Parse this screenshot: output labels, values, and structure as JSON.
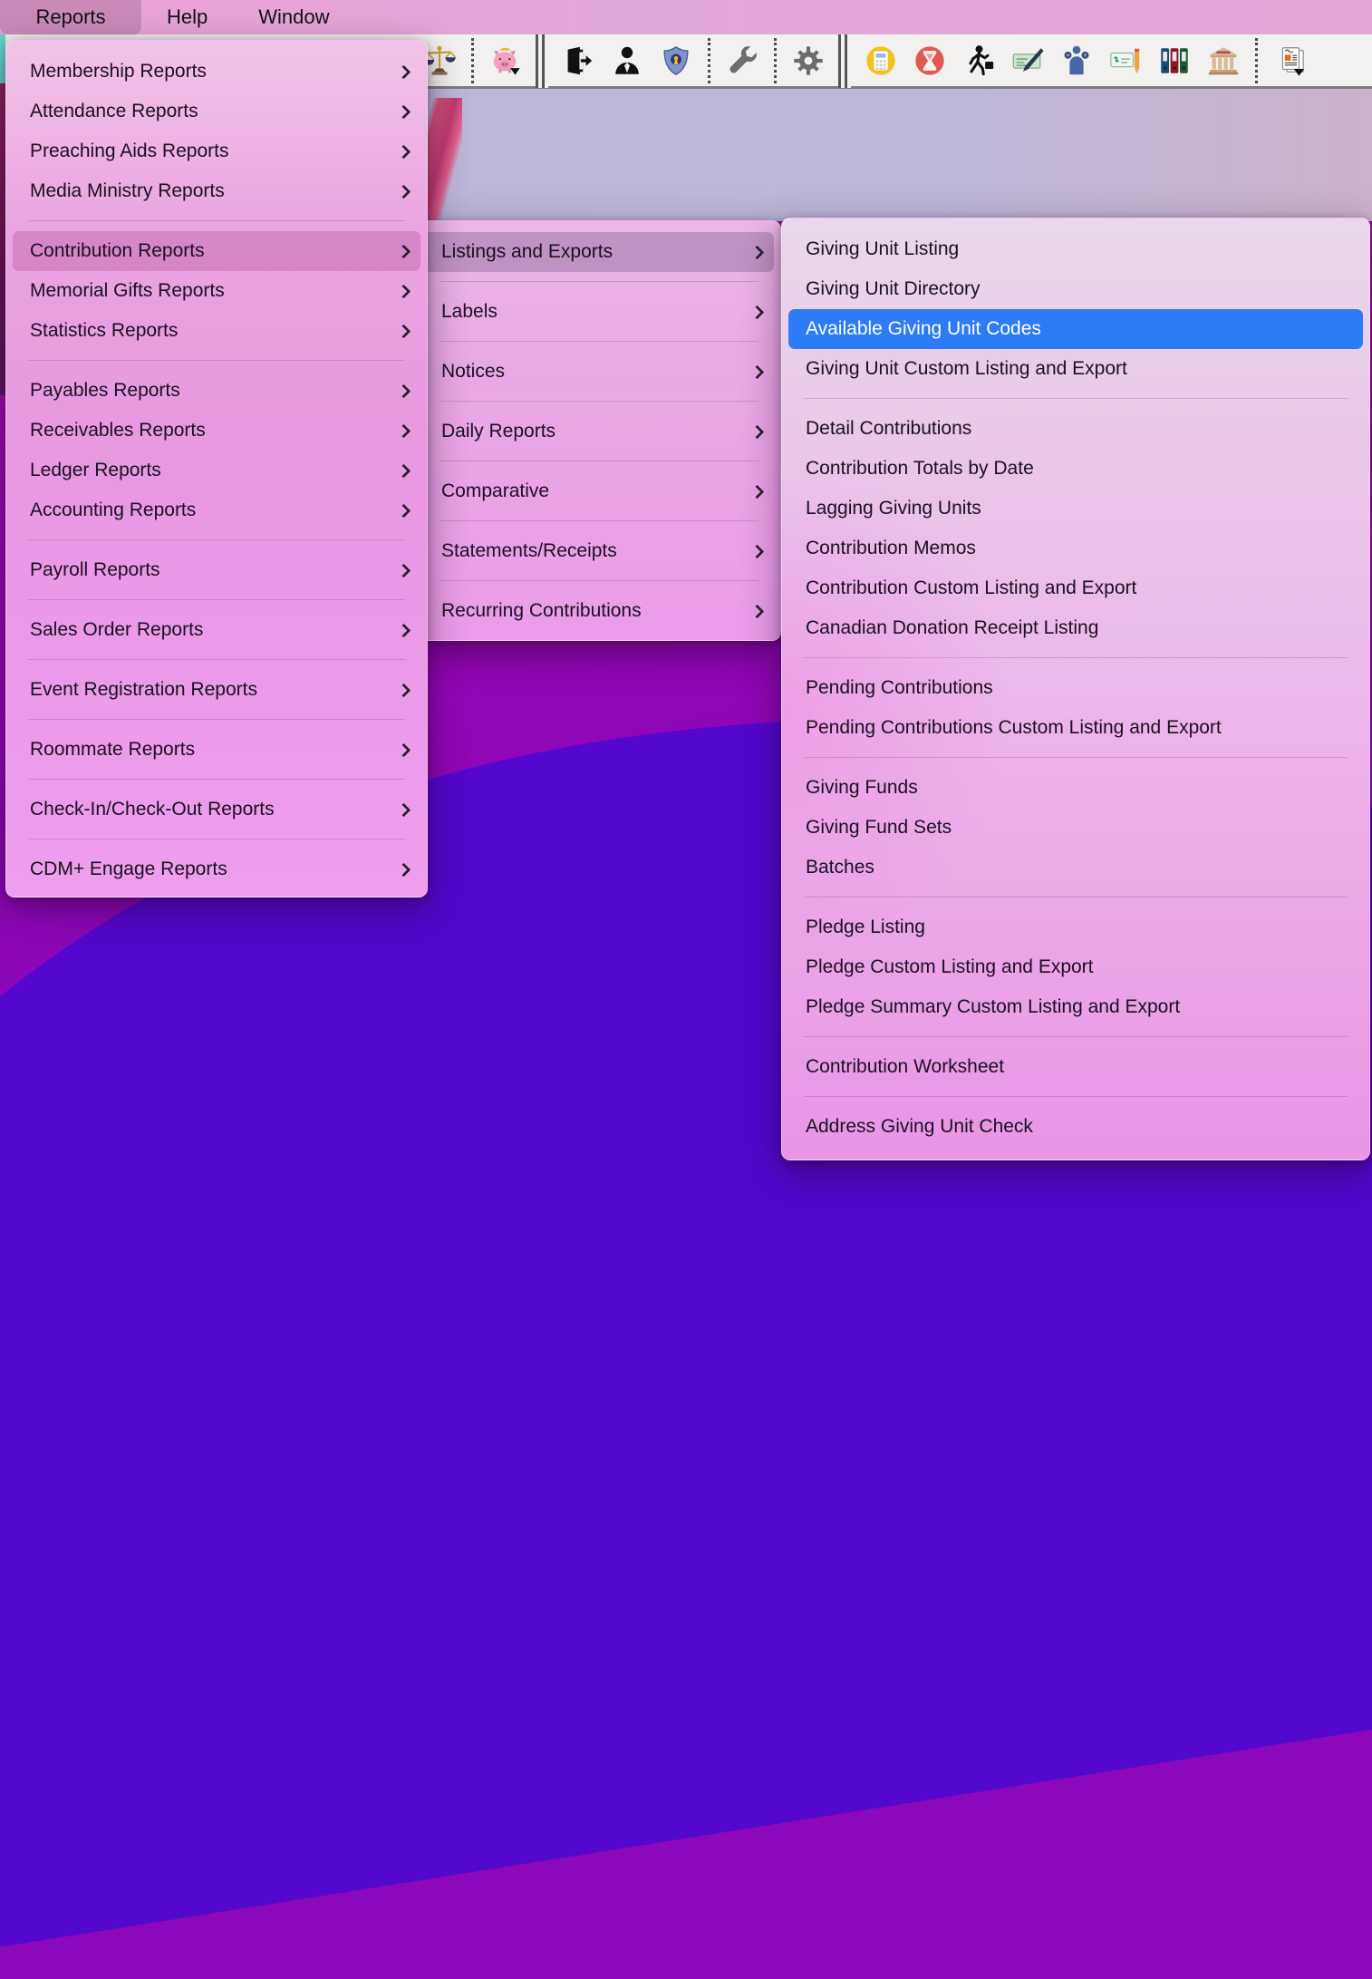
{
  "menu_bar": {
    "items": [
      {
        "label": "Reports",
        "selected": true
      },
      {
        "label": "Help",
        "selected": false
      },
      {
        "label": "Window",
        "selected": false
      }
    ]
  },
  "toolbar": {
    "icons": [
      "scales-icon",
      "piggy-bank-icon",
      "exit-door-icon",
      "person-icon",
      "shield-icon",
      "wrench-icon",
      "gear-icon",
      "calculator-icon",
      "hourglass-icon",
      "walking-person-icon",
      "check-pen-icon",
      "person-money-icon",
      "check-pencil-icon",
      "binders-icon",
      "bank-icon",
      "document-icon"
    ]
  },
  "menus": {
    "reports": {
      "items": [
        {
          "label": "Membership Reports",
          "submenu": true
        },
        {
          "label": "Attendance Reports",
          "submenu": true
        },
        {
          "label": "Preaching Aids Reports",
          "submenu": true
        },
        {
          "label": "Media Ministry Reports",
          "submenu": true,
          "separator_after": true
        },
        {
          "label": "Contribution Reports",
          "submenu": true,
          "highlight": "pink"
        },
        {
          "label": "Memorial Gifts Reports",
          "submenu": true
        },
        {
          "label": "Statistics Reports",
          "submenu": true,
          "separator_after": true
        },
        {
          "label": "Payables Reports",
          "submenu": true
        },
        {
          "label": "Receivables Reports",
          "submenu": true
        },
        {
          "label": "Ledger Reports",
          "submenu": true
        },
        {
          "label": "Accounting Reports",
          "submenu": true,
          "separator_after": true
        },
        {
          "label": "Payroll Reports",
          "submenu": true,
          "separator_after": true
        },
        {
          "label": "Sales Order Reports",
          "submenu": true,
          "separator_after": true
        },
        {
          "label": "Event Registration Reports",
          "submenu": true,
          "separator_after": true
        },
        {
          "label": "Roommate Reports",
          "submenu": true,
          "separator_after": true
        },
        {
          "label": "Check-In/Check-Out Reports",
          "submenu": true,
          "separator_after": true
        },
        {
          "label": "CDM+ Engage Reports",
          "submenu": true
        }
      ]
    },
    "contribution_reports": {
      "items": [
        {
          "label": "Listings and Exports",
          "submenu": true,
          "highlight": "gray",
          "separator_after": true
        },
        {
          "label": "Labels",
          "submenu": true,
          "separator_after": true
        },
        {
          "label": "Notices",
          "submenu": true,
          "separator_after": true
        },
        {
          "label": "Daily Reports",
          "submenu": true,
          "separator_after": true
        },
        {
          "label": "Comparative",
          "submenu": true,
          "separator_after": true
        },
        {
          "label": "Statements/Receipts",
          "submenu": true,
          "separator_after": true
        },
        {
          "label": "Recurring Contributions",
          "submenu": true
        }
      ]
    },
    "listings_and_exports": {
      "items": [
        {
          "label": "Giving Unit Listing"
        },
        {
          "label": "Giving Unit Directory"
        },
        {
          "label": "Available Giving Unit Codes",
          "highlight": "blue"
        },
        {
          "label": "Giving Unit Custom Listing and Export",
          "separator_after": true
        },
        {
          "label": "Detail Contributions"
        },
        {
          "label": "Contribution Totals by Date"
        },
        {
          "label": "Lagging Giving Units"
        },
        {
          "label": "Contribution Memos"
        },
        {
          "label": "Contribution Custom Listing and Export"
        },
        {
          "label": "Canadian Donation Receipt Listing",
          "separator_after": true
        },
        {
          "label": "Pending Contributions"
        },
        {
          "label": "Pending Contributions Custom Listing and Export",
          "separator_after": true
        },
        {
          "label": "Giving Funds"
        },
        {
          "label": "Giving Fund Sets"
        },
        {
          "label": "Batches",
          "separator_after": true
        },
        {
          "label": "Pledge Listing"
        },
        {
          "label": "Pledge Custom Listing and Export"
        },
        {
          "label": "Pledge Summary Custom Listing and Export",
          "separator_after": true
        },
        {
          "label": "Contribution Worksheet",
          "separator_after": true
        },
        {
          "label": "Address Giving Unit Check"
        }
      ]
    }
  },
  "colors": {
    "selection_blue": "#2e7bf7",
    "menubar_pink": "#e4a4d6",
    "menubar_selected_mauve": "#c98ab7",
    "toolbar_gray": "#f2f1ef",
    "wallpaper_lavender": "#bdb8d8",
    "wallpaper_magenta": "#a506aa",
    "wallpaper_violet_wave": "#5407cd",
    "menu_text": "#1b1120"
  }
}
